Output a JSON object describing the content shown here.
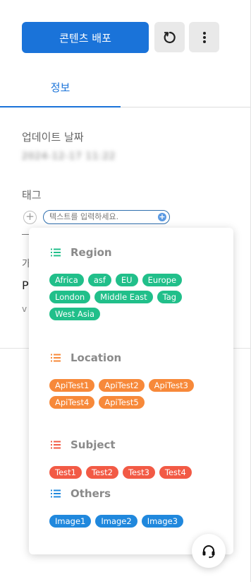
{
  "header": {
    "deploy_label": "콘텐츠 배포",
    "refresh_icon": "refresh-icon",
    "more_icon": "more-vertical-icon"
  },
  "tabs": [
    {
      "label": "정보",
      "active": true
    }
  ],
  "info": {
    "updated_label": "업데이트 날짜",
    "updated_value": "2024-12-17 11:22",
    "tags_label": "태그",
    "tag_input_placeholder": "텍스트를 입력하세요.",
    "peek": [
      "가",
      "P",
      "v"
    ]
  },
  "tag_dropdown": {
    "groups": [
      {
        "title": "Region",
        "color": "#21bf8a",
        "tags": [
          "Africa",
          "asf",
          "EU",
          "Europe",
          "London",
          "Middle East",
          "Tag",
          "West Asia"
        ]
      },
      {
        "title": "Location",
        "color": "#f7893a",
        "tags": [
          "ApiTest1",
          "ApiTest2",
          "ApiTest3",
          "ApiTest4",
          "ApiTest5"
        ]
      },
      {
        "title": "Subject",
        "color": "#f25a45",
        "tags": [
          "Test1",
          "Test2",
          "Test3",
          "Test4"
        ]
      },
      {
        "title": "Others",
        "color": "#2088dd",
        "tags": [
          "Image1",
          "Image2",
          "Image3"
        ]
      }
    ]
  },
  "support": {
    "icon": "headset-icon"
  },
  "colors": {
    "primary": "#1a73d9"
  }
}
